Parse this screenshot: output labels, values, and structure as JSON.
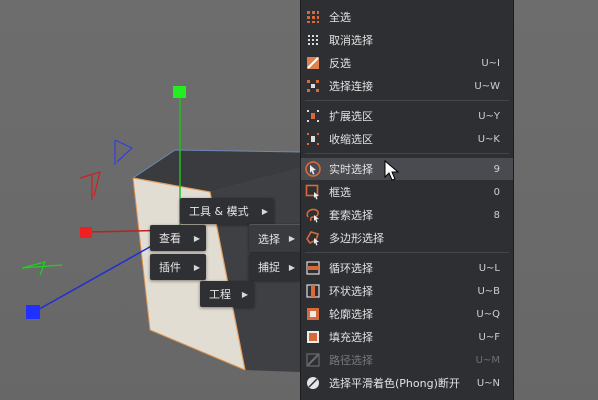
{
  "popups": {
    "tools_modes": "工具 & 模式",
    "view": "查看",
    "select": "选择",
    "plugins": "插件",
    "snap": "捕捉",
    "project": "工程"
  },
  "menu": {
    "items": [
      {
        "label": "全选",
        "shortcut": "",
        "icon": "select-all-icon"
      },
      {
        "label": "取消选择",
        "shortcut": "",
        "icon": "deselect-icon"
      },
      {
        "label": "反选",
        "shortcut": "U~I",
        "icon": "invert-selection-icon"
      },
      {
        "label": "选择连接",
        "shortcut": "U~W",
        "icon": "select-connected-icon"
      },
      {
        "label": "扩展选区",
        "shortcut": "U~Y",
        "icon": "grow-selection-icon"
      },
      {
        "label": "收缩选区",
        "shortcut": "U~K",
        "icon": "shrink-selection-icon"
      },
      {
        "label": "实时选择",
        "shortcut": "9",
        "icon": "live-selection-icon"
      },
      {
        "label": "框选",
        "shortcut": "0",
        "icon": "rectangle-selection-icon"
      },
      {
        "label": "套索选择",
        "shortcut": "8",
        "icon": "lasso-selection-icon"
      },
      {
        "label": "多边形选择",
        "shortcut": "",
        "icon": "polygon-selection-icon"
      },
      {
        "label": "循环选择",
        "shortcut": "U~L",
        "icon": "loop-selection-icon"
      },
      {
        "label": "环状选择",
        "shortcut": "U~B",
        "icon": "ring-selection-icon"
      },
      {
        "label": "轮廓选择",
        "shortcut": "U~Q",
        "icon": "outline-selection-icon"
      },
      {
        "label": "填充选择",
        "shortcut": "U~F",
        "icon": "fill-selection-icon"
      },
      {
        "label": "路径选择",
        "shortcut": "U~M",
        "icon": "path-selection-icon"
      },
      {
        "label": "选择平滑着色(Phong)断开",
        "shortcut": "U~N",
        "icon": "phong-break-selection-icon"
      }
    ]
  },
  "colors": {
    "menu_bg": "#2e2f33",
    "highlight": "#4a4b50",
    "axis_x": "#e02020",
    "axis_y": "#20d020",
    "axis_z": "#2030e0",
    "icon_orange": "#d86a3a"
  }
}
